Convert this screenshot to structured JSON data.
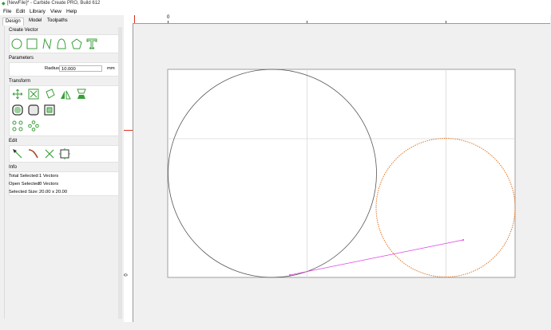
{
  "window": {
    "title": "[NewFile]* - Carbide Create PRO, Build 612"
  },
  "menu": [
    "File",
    "Edit",
    "Library",
    "View",
    "Help"
  ],
  "tabs": [
    "Design",
    "Model",
    "Toolpaths"
  ],
  "panel": {
    "create_vector_title": "Create Vector",
    "parameters_title": "Parameters",
    "radius_label": "Radius",
    "radius_value": "10.000",
    "radius_unit": "mm",
    "transform_title": "Transform",
    "edit_title": "Edit",
    "info_title": "Info",
    "info": {
      "total_label": "Total Selected:",
      "total_value": "1 Vectors",
      "open_label": "Open Selected:",
      "open_value": "0 Vectors",
      "size_label": "Selected Size:",
      "size_value": "20.00 x 20.00"
    }
  },
  "ruler": {
    "top_zero": "0",
    "left_zero": "0"
  },
  "colors": {
    "accent_green": "#3a9e3a",
    "selected_orange": "#e07a2a",
    "line_magenta": "#e040e0",
    "ruler_marker": "#e03020"
  },
  "icons": {
    "create": [
      "circle-icon",
      "rectangle-icon",
      "polyline-icon",
      "curve-icon",
      "polygon-icon",
      "text-icon"
    ],
    "transform_row1": [
      "move-icon",
      "scale-icon",
      "rotate-icon",
      "mirror-icon",
      "flip-icon"
    ],
    "transform_row2": [
      "offset-icon",
      "fillet-icon",
      "boolean-icon"
    ],
    "transform_row3": [
      "array-icon",
      "circular-array-icon"
    ],
    "edit": [
      "node-edit-icon",
      "smooth-icon",
      "cut-icon",
      "bounding-box-icon"
    ]
  }
}
